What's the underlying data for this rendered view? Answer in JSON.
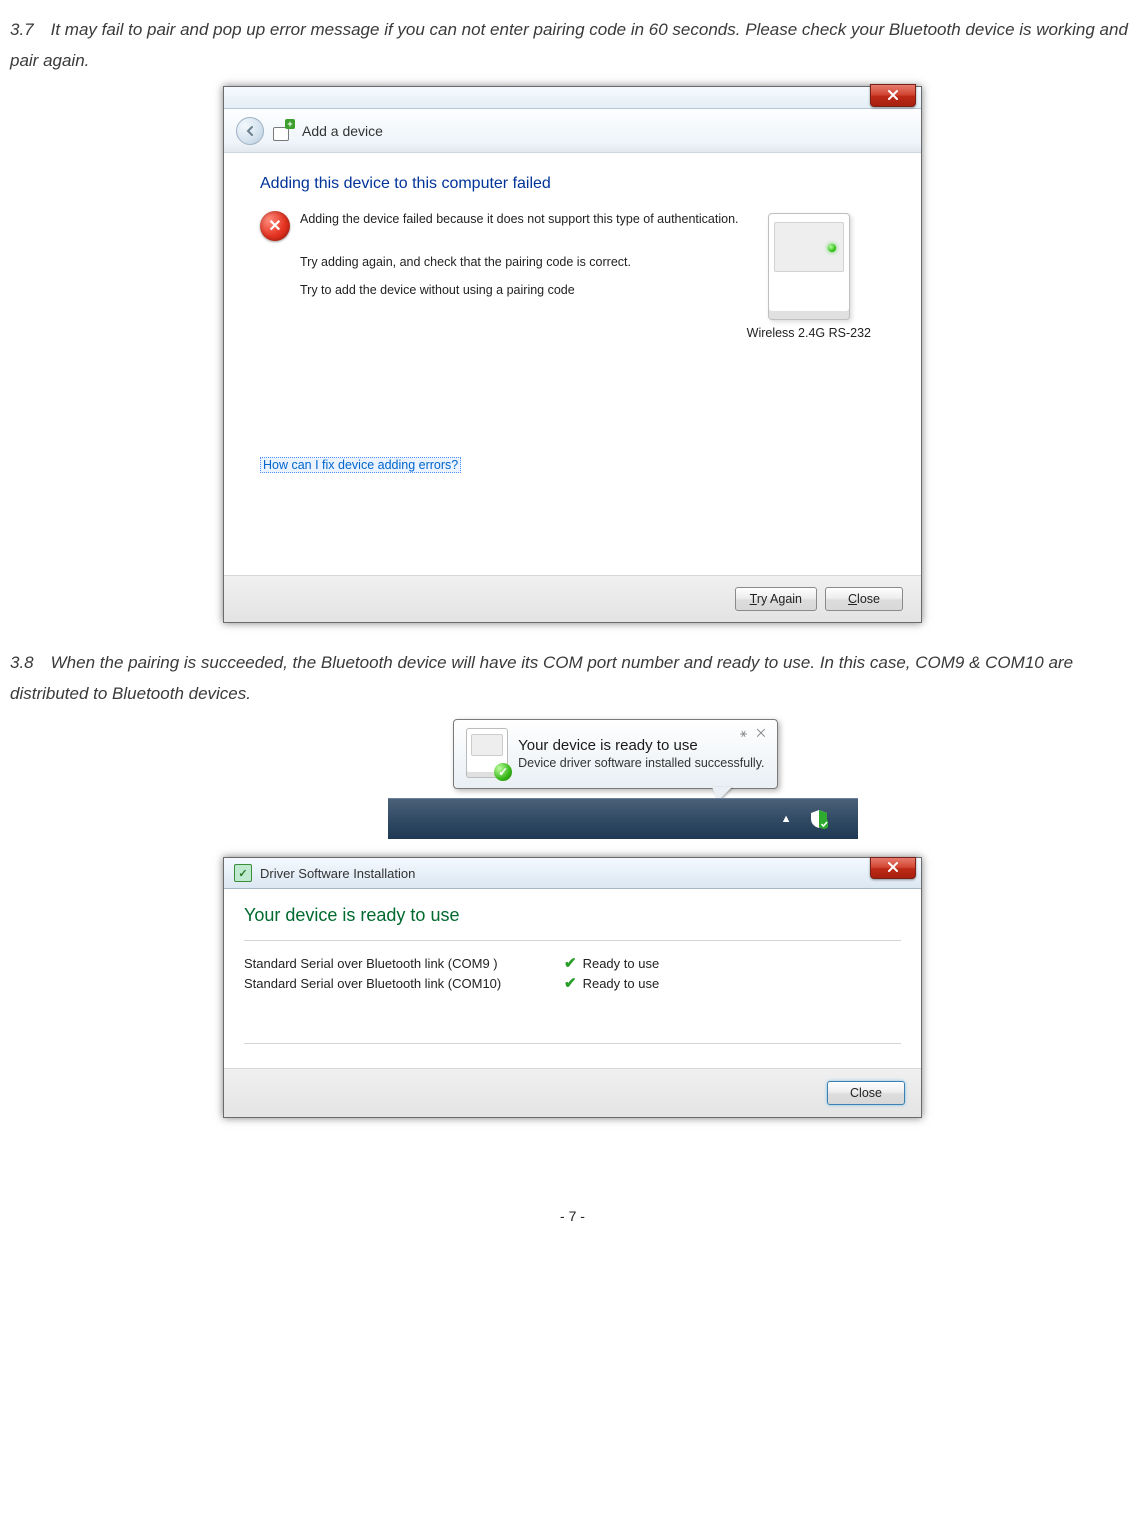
{
  "step37": "3.7 It may fail to pair and pop up error message if you can not enter pairing code in 60 seconds. Please check your Bluetooth device is working and pair again.",
  "step38": "3.8 When the pairing is succeeded, the Bluetooth device will have its COM port number and ready to use. In this case, COM9 & COM10 are distributed to Bluetooth devices.",
  "page_number": "- 7 -",
  "window1": {
    "header_title": "Add a device",
    "heading": "Adding this device to this computer failed",
    "error_msg": "Adding the device failed because it does not support this type of authentication.",
    "line2": "Try adding again, and check that the pairing code is correct.",
    "line3": "Try to add the device without using a pairing code",
    "device_name": "Wireless 2.4G RS-232",
    "help_link": "How can I fix device adding errors?",
    "btn_try": "Try Again",
    "btn_close": "Close"
  },
  "balloon": {
    "title": "Your device is ready to use",
    "subtitle": "Device driver software installed successfully."
  },
  "window3": {
    "title": "Driver Software Installation",
    "heading": "Your device is ready to use",
    "rows": [
      {
        "name": "Standard Serial over Bluetooth link (COM9 )",
        "status": "Ready to use"
      },
      {
        "name": "Standard Serial over Bluetooth link (COM10)",
        "status": "Ready to use"
      }
    ],
    "btn_close": "Close"
  }
}
